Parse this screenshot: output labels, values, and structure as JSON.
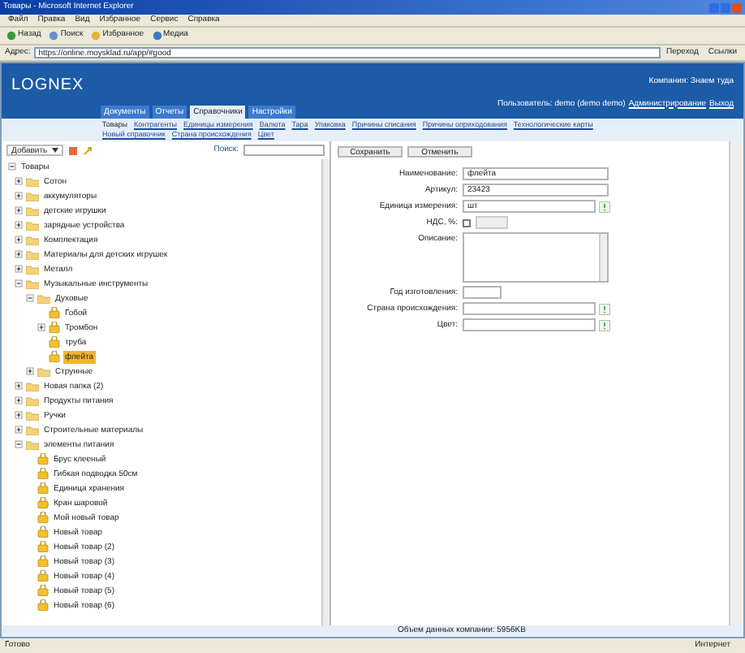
{
  "window": {
    "title": "Товары - Microsoft Internet Explorer"
  },
  "menu": [
    "Файл",
    "Правка",
    "Вид",
    "Избранное",
    "Сервис",
    "Справка"
  ],
  "toolbar": [
    "Назад",
    "Поиск",
    "Избранное",
    "Медиа"
  ],
  "address": {
    "label": "Адрес:",
    "url": "https://online.moysklad.ru/app/#good",
    "go": "Переход",
    "links": "Ссылки"
  },
  "app": {
    "logo": "LOGNEX",
    "company": "Компания: Знаем туда",
    "user": "Пользователь: demo (demo demo)",
    "user_links": [
      "Администрирование",
      "Выход"
    ],
    "tabs": [
      {
        "label": "Документы",
        "selected": false
      },
      {
        "label": "Отчеты",
        "selected": false
      },
      {
        "label": "Справочники",
        "selected": true
      },
      {
        "label": "Настройки",
        "selected": false
      }
    ],
    "subnav": [
      [
        {
          "label": "Товары",
          "selected": true
        },
        {
          "label": "Контрагенты",
          "selected": false
        },
        {
          "label": "Единицы измерения",
          "selected": false
        },
        {
          "label": "Валюта",
          "selected": false
        },
        {
          "label": "Тара",
          "selected": false
        },
        {
          "label": "Упаковка",
          "selected": false
        },
        {
          "label": "Причины списания",
          "selected": false
        },
        {
          "label": "Причины оприходования",
          "selected": false
        },
        {
          "label": "Технологические карты",
          "selected": false
        }
      ],
      [
        {
          "label": "Новый справочник",
          "selected": false
        },
        {
          "label": "Страна происхождения",
          "selected": false
        },
        {
          "label": "Цвет",
          "selected": false
        }
      ]
    ]
  },
  "left": {
    "add": "Добавить",
    "search_label": "Поиск:"
  },
  "tree": [
    {
      "label": "Товары",
      "kind": "root",
      "expanded": true,
      "selected": false,
      "children": [
        {
          "label": "Сотон",
          "kind": "folder",
          "expanded": false,
          "selected": false
        },
        {
          "label": "аккумуляторы",
          "kind": "folder",
          "expanded": false,
          "selected": false
        },
        {
          "label": "детские игрушки",
          "kind": "folder",
          "expanded": false,
          "selected": false
        },
        {
          "label": "зарядные устройства",
          "kind": "folder",
          "expanded": false,
          "selected": false
        },
        {
          "label": "Комплектация",
          "kind": "folder",
          "expanded": false,
          "selected": false
        },
        {
          "label": "Материалы для детских игрушек",
          "kind": "folder",
          "expanded": false,
          "selected": false
        },
        {
          "label": "Металл",
          "kind": "folder",
          "expanded": false,
          "selected": false
        },
        {
          "label": "Музыкальные инструменты",
          "kind": "folder",
          "expanded": true,
          "selected": false,
          "children": [
            {
              "label": "Духовые",
              "kind": "folder",
              "expanded": true,
              "selected": false,
              "children": [
                {
                  "label": "Гобой",
                  "kind": "item",
                  "selected": false
                },
                {
                  "label": "Тромбон",
                  "kind": "item",
                  "expanded": false,
                  "selected": false
                },
                {
                  "label": "труба",
                  "kind": "item",
                  "selected": false
                },
                {
                  "label": "флейта",
                  "kind": "item",
                  "selected": true
                }
              ]
            },
            {
              "label": "Струнные",
              "kind": "folder",
              "expanded": false,
              "selected": false
            }
          ]
        },
        {
          "label": "Новая папка (2)",
          "kind": "folder",
          "expanded": false,
          "selected": false
        },
        {
          "label": "Продукты питания",
          "kind": "folder",
          "expanded": false,
          "selected": false
        },
        {
          "label": "Ручки",
          "kind": "folder",
          "expanded": false,
          "selected": false
        },
        {
          "label": "Строительные материалы",
          "kind": "folder",
          "expanded": false,
          "selected": false
        },
        {
          "label": "элементы питания",
          "kind": "folder",
          "expanded": true,
          "selected": false,
          "children": [
            {
              "label": "Брус клееный",
              "kind": "item",
              "selected": false
            },
            {
              "label": "Гибкая подводка 50см",
              "kind": "item",
              "selected": false
            },
            {
              "label": "Единица хранения",
              "kind": "item",
              "selected": false
            },
            {
              "label": "Кран шаровой",
              "kind": "item",
              "selected": false
            },
            {
              "label": "Мой новый товар",
              "kind": "item",
              "selected": false
            },
            {
              "label": "Новый товар",
              "kind": "item",
              "selected": false
            },
            {
              "label": "Новый товар (2)",
              "kind": "item",
              "selected": false
            },
            {
              "label": "Новый товар (3)",
              "kind": "item",
              "selected": false
            },
            {
              "label": "Новый товар (4)",
              "kind": "item",
              "selected": false
            },
            {
              "label": "Новый товар (5)",
              "kind": "item",
              "selected": false
            },
            {
              "label": "Новый товар (6)",
              "kind": "item",
              "selected": false
            }
          ]
        }
      ]
    }
  ],
  "buttons": [
    "Сохранить",
    "Отменить"
  ],
  "form": [
    {
      "label": "Наименование:",
      "kind": "text",
      "value": "флейта"
    },
    {
      "label": "Артикул:",
      "kind": "text",
      "value": "23423"
    },
    {
      "label": "Единица измерения:",
      "kind": "select",
      "value": "шт"
    },
    {
      "label": "НДС, %:",
      "kind": "checkbox",
      "checked": false
    },
    {
      "label": "Описание:",
      "kind": "textarea"
    },
    {
      "label": "Год изготовления:",
      "kind": "short"
    },
    {
      "label": "Страна происхождения:",
      "kind": "select"
    },
    {
      "label": "Цвет:",
      "kind": "select"
    }
  ],
  "footer": "Объем данных компании: 5956KB",
  "status": {
    "text": "Готово",
    "zone": "Интернет"
  }
}
